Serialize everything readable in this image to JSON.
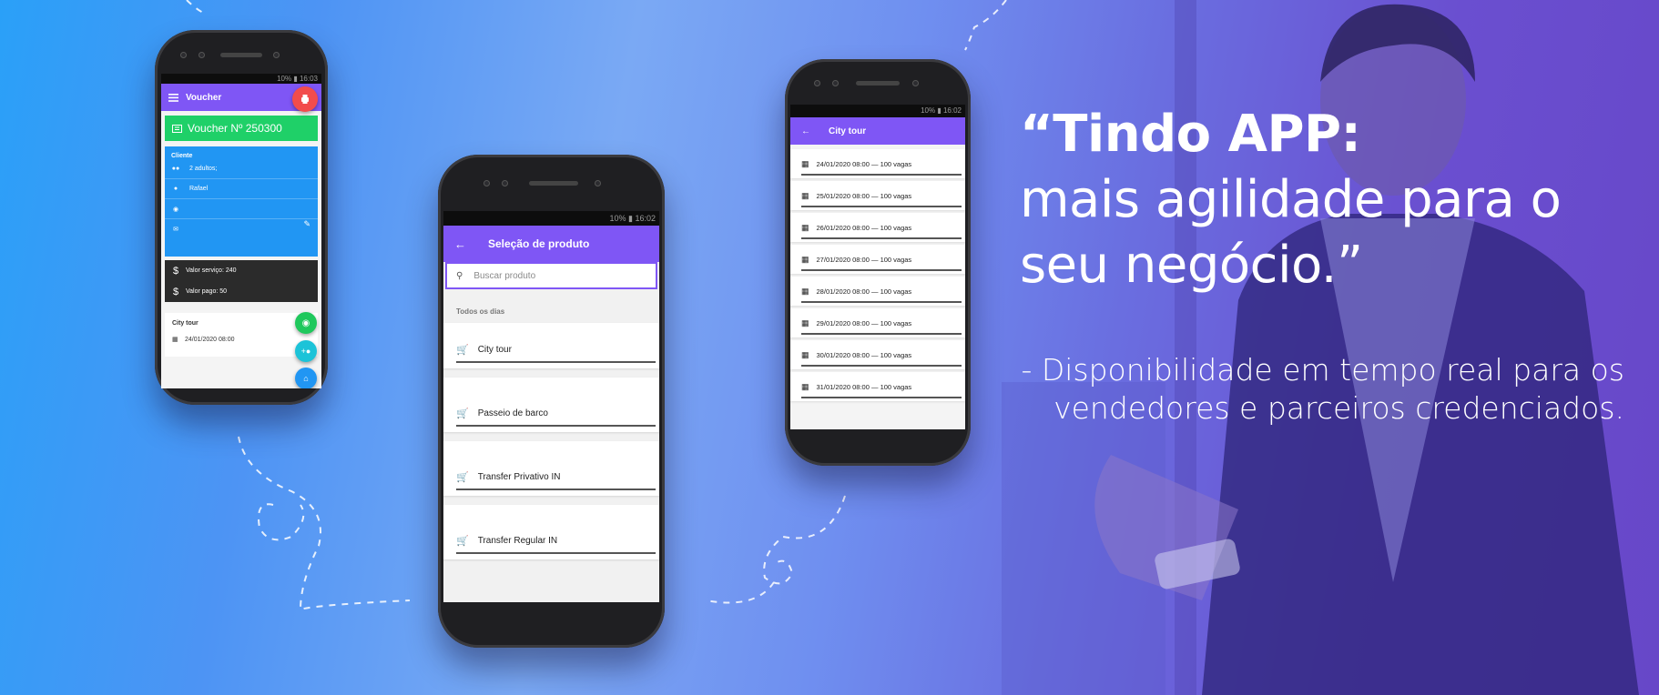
{
  "colors": {
    "accent": "#7f56f5",
    "green": "#1fd068",
    "blue": "#2196f3",
    "dark": "#2b2b2b",
    "red": "#f24c4c",
    "whatsapp": "#1fc85c",
    "teal": "#1cc3d8"
  },
  "status_bar": {
    "p1": "10% ▮ 16:03",
    "p2": "10% ▮ 16:02",
    "p3": "10% ▮ 16:02"
  },
  "phone1": {
    "appbar": {
      "title": "Voucher",
      "menu_icon": "hamburger-icon",
      "fab_icon": "print-icon"
    },
    "voucher_label": "Voucher Nº 250300",
    "cliente": {
      "heading": "Cliente",
      "pax": "2 adultos;",
      "name": "Rafael"
    },
    "payments": {
      "service": "Valor serviço: 240",
      "paid": "Valor pago: 50"
    },
    "tour": {
      "heading": "City tour",
      "date": "24/01/2020 08:00"
    }
  },
  "phone2": {
    "appbar": {
      "title": "Seleção de produto"
    },
    "search": {
      "placeholder": "Buscar produto"
    },
    "section": "Todos os dias",
    "products": [
      "City tour",
      "Passeio de barco",
      "Transfer Privativo IN",
      "Transfer Regular IN"
    ]
  },
  "phone3": {
    "appbar": {
      "title": "City tour"
    },
    "dates": [
      "24/01/2020 08:00 — 100 vagas",
      "25/01/2020 08:00 — 100 vagas",
      "26/01/2020 08:00 — 100 vagas",
      "27/01/2020 08:00 — 100 vagas",
      "28/01/2020 08:00 — 100 vagas",
      "29/01/2020 08:00 — 100 vagas",
      "30/01/2020 08:00 — 100 vagas",
      "31/01/2020 08:00 — 100 vagas"
    ]
  },
  "headline": {
    "line1": "“Tindo APP:",
    "line2": "mais agilidade para o",
    "line3": "seu negócio.”"
  },
  "subtitle": {
    "line1": "- Disponibilidade em tempo real para os",
    "line2": "vendedores e parceiros credenciados."
  }
}
